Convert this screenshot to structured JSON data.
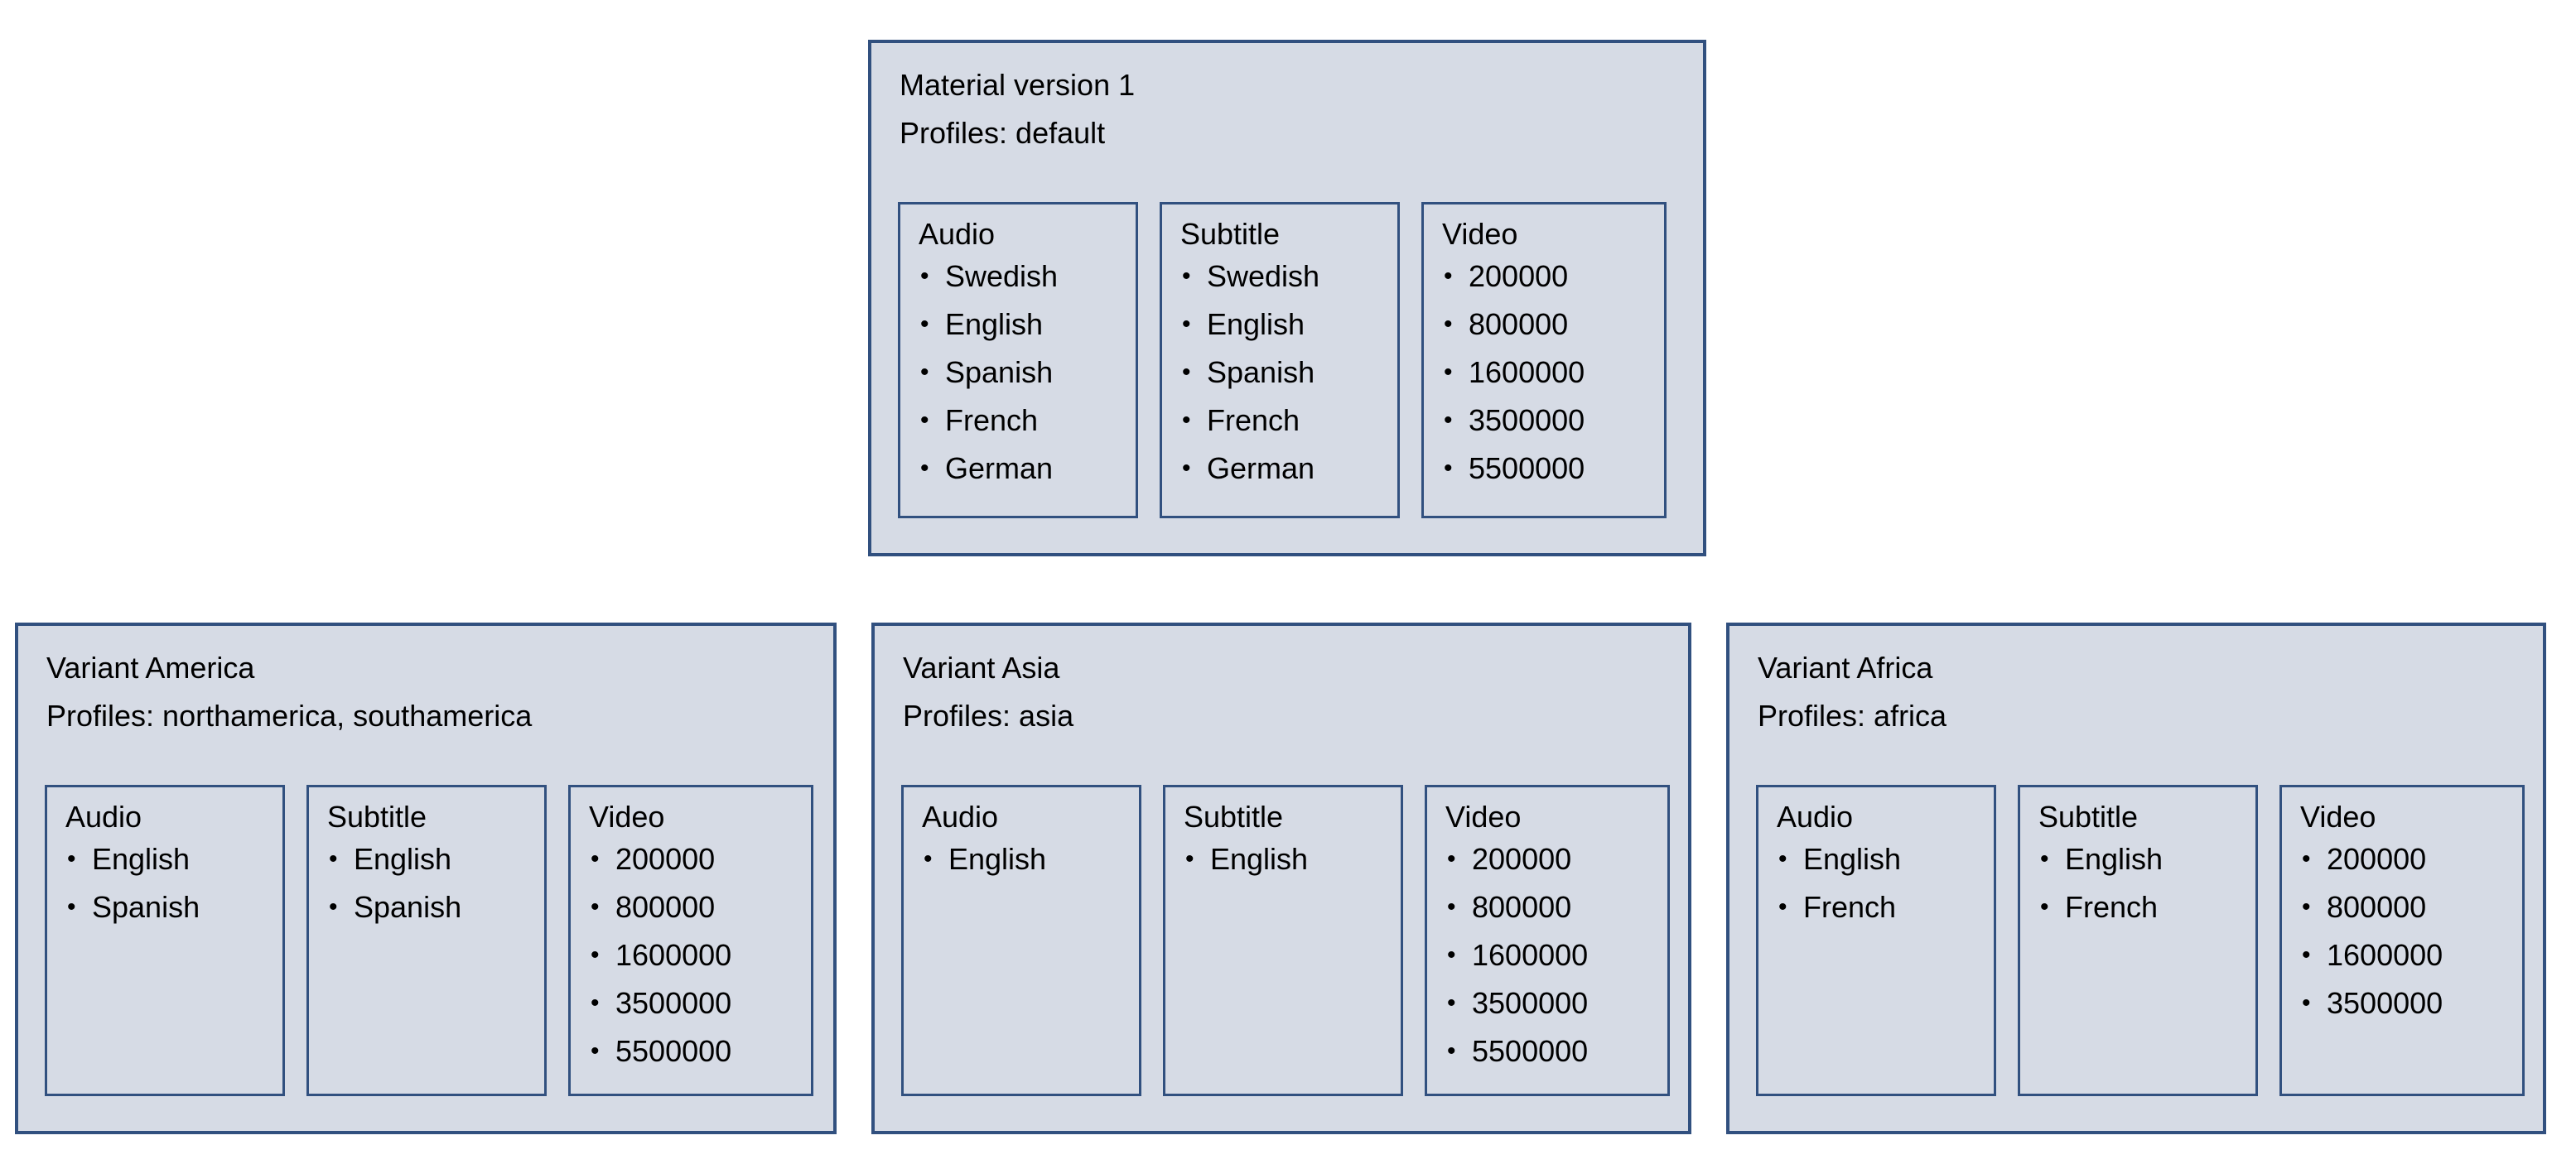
{
  "colors": {
    "panel_fill": "#D6DBE5",
    "panel_border": "#31507F",
    "page_background": "#FFFFFF",
    "text": "#000000"
  },
  "diagram": {
    "type": "hierarchy",
    "master": {
      "title": "Material version 1",
      "profiles_line": "Profiles: default",
      "tracks": [
        {
          "name": "Audio",
          "items": [
            "Swedish",
            "English",
            "Spanish",
            "French",
            "German"
          ]
        },
        {
          "name": "Subtitle",
          "items": [
            "Swedish",
            "English",
            "Spanish",
            "French",
            "German"
          ]
        },
        {
          "name": "Video",
          "items": [
            "200000",
            "800000",
            "1600000",
            "3500000",
            "5500000"
          ]
        }
      ]
    },
    "variants": [
      {
        "title": "Variant America",
        "profiles_line": "Profiles: northamerica, southamerica",
        "tracks": [
          {
            "name": "Audio",
            "items": [
              "English",
              "Spanish"
            ]
          },
          {
            "name": "Subtitle",
            "items": [
              "English",
              "Spanish"
            ]
          },
          {
            "name": "Video",
            "items": [
              "200000",
              "800000",
              "1600000",
              "3500000",
              "5500000"
            ]
          }
        ]
      },
      {
        "title": "Variant Asia",
        "profiles_line": "Profiles: asia",
        "tracks": [
          {
            "name": "Audio",
            "items": [
              "English"
            ]
          },
          {
            "name": "Subtitle",
            "items": [
              "English"
            ]
          },
          {
            "name": "Video",
            "items": [
              "200000",
              "800000",
              "1600000",
              "3500000",
              "5500000"
            ]
          }
        ]
      },
      {
        "title": "Variant Africa",
        "profiles_line": "Profiles: africa",
        "tracks": [
          {
            "name": "Audio",
            "items": [
              "English",
              "French"
            ]
          },
          {
            "name": "Subtitle",
            "items": [
              "English",
              "French"
            ]
          },
          {
            "name": "Video",
            "items": [
              "200000",
              "800000",
              "1600000",
              "3500000"
            ]
          }
        ]
      }
    ]
  }
}
